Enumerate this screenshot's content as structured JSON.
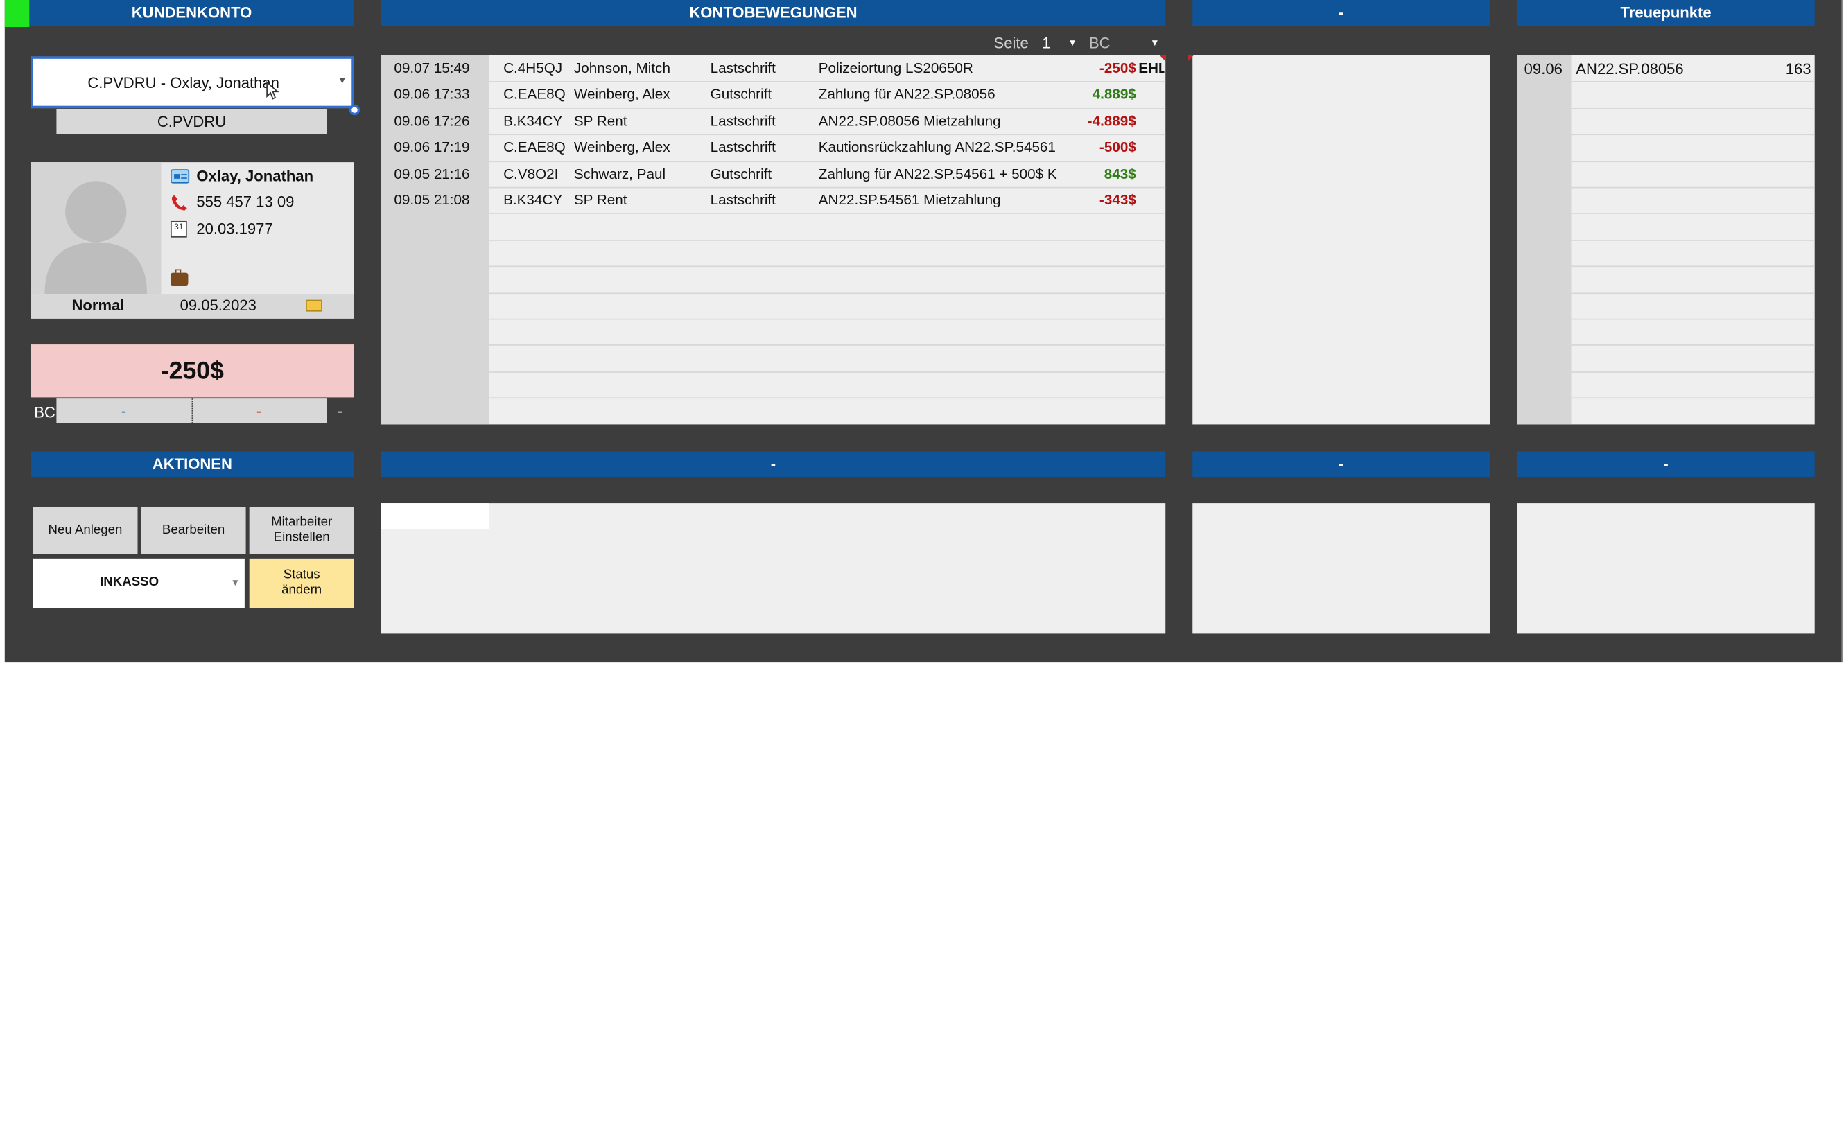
{
  "headers": {
    "kundenkonto": "KUNDENKONTO",
    "kontobewegungen": "KONTOBEWEGUNGEN",
    "third": "-",
    "treuepunkte": "Treuepunkte",
    "aktionen": "AKTIONEN",
    "bottom_mid": "-",
    "bottom_third": "-",
    "bottom_right": "-"
  },
  "customer": {
    "selector_value": "C.PVDRU - Oxlay, Jonathan",
    "code": "C.PVDRU",
    "name": "Oxlay, Jonathan",
    "phone": "555 457 13 09",
    "birthdate": "20.03.1977",
    "status": "Normal",
    "date": "09.05.2023",
    "balance": "-250$",
    "bc_label": "BC",
    "bc_value1": "-",
    "bc_value2": "-",
    "bc_value3": "-"
  },
  "pager": {
    "label": "Seite",
    "page": "1",
    "filter": "BC"
  },
  "transactions": [
    {
      "datetime": "09.07 15:49",
      "code": "C.4H5QJ",
      "name": "Johnson, Mitch",
      "type": "Lastschrift",
      "desc": "Polizeiortung LS20650R",
      "amount": "-250$",
      "sign": "neg",
      "extra": "EHL"
    },
    {
      "datetime": "09.06 17:33",
      "code": "C.EAE8Q",
      "name": "Weinberg, Alex",
      "type": "Gutschrift",
      "desc": "Zahlung für AN22.SP.08056",
      "amount": "4.889$",
      "sign": "pos",
      "extra": ""
    },
    {
      "datetime": "09.06 17:26",
      "code": "B.K34CY",
      "name": "SP Rent",
      "type": "Lastschrift",
      "desc": "AN22.SP.08056 Mietzahlung",
      "amount": "-4.889$",
      "sign": "neg",
      "extra": ""
    },
    {
      "datetime": "09.06 17:19",
      "code": "C.EAE8Q",
      "name": "Weinberg, Alex",
      "type": "Lastschrift",
      "desc": "Kautionsrückzahlung AN22.SP.54561",
      "amount": "-500$",
      "sign": "neg",
      "extra": ""
    },
    {
      "datetime": "09.05 21:16",
      "code": "C.V8O2I",
      "name": "Schwarz, Paul",
      "type": "Gutschrift",
      "desc": "Zahlung für AN22.SP.54561 + 500$ K",
      "amount": "843$",
      "sign": "pos",
      "extra": ""
    },
    {
      "datetime": "09.05 21:08",
      "code": "B.K34CY",
      "name": "SP Rent",
      "type": "Lastschrift",
      "desc": "AN22.SP.54561 Mietzahlung",
      "amount": "-343$",
      "sign": "neg",
      "extra": ""
    }
  ],
  "loyalty": [
    {
      "date": "09.06",
      "ref": "AN22.SP.08056",
      "points": "163"
    }
  ],
  "actions": {
    "new": "Neu Anlegen",
    "edit": "Bearbeiten",
    "staff_line1": "Mitarbeiter",
    "staff_line2": "Einstellen",
    "inkasso": "INKASSO",
    "status_line1": "Status",
    "status_line2": "ändern"
  },
  "colors": {
    "header_blue": "#0f5399",
    "background_dark": "#3d3d3d",
    "panel_light": "#efefef",
    "negative": "#b01212",
    "positive": "#2e7d16",
    "balance_bg": "#f3c9c9",
    "status_button": "#fde59a",
    "marker_green": "#1fe51f"
  },
  "icons": [
    "contact-card-icon",
    "phone-icon",
    "calendar-icon",
    "briefcase-icon",
    "folder-icon",
    "dropdown-arrow-icon",
    "mouse-cursor-icon"
  ]
}
